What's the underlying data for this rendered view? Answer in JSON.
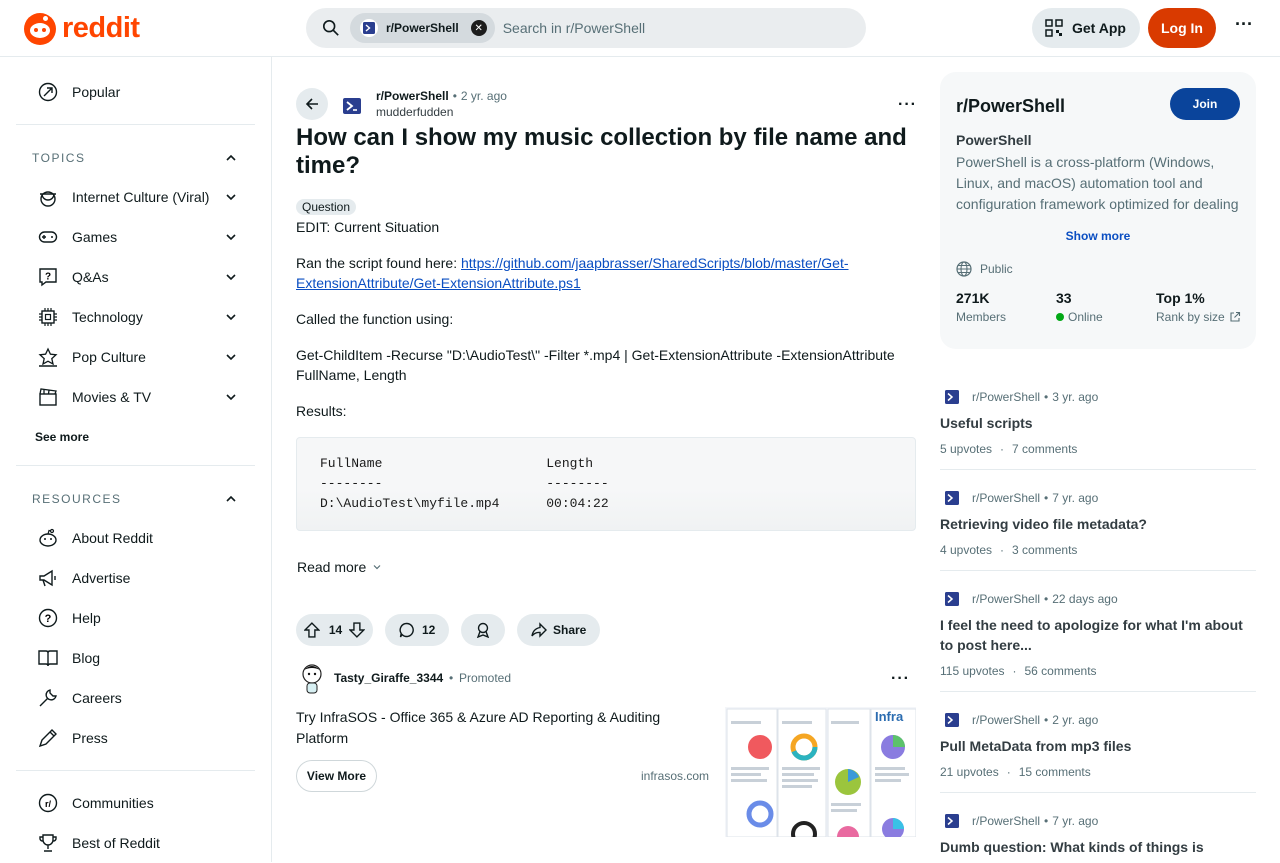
{
  "header": {
    "logo_text": "reddit",
    "search_chip": "r/PowerShell",
    "search_placeholder": "Search in r/PowerShell",
    "get_app": "Get App",
    "login": "Log In"
  },
  "leftnav": {
    "popular": "Popular",
    "topics_heading": "TOPICS",
    "topics": [
      "Internet Culture (Viral)",
      "Games",
      "Q&As",
      "Technology",
      "Pop Culture",
      "Movies & TV"
    ],
    "see_more": "See more",
    "resources_heading": "RESOURCES",
    "resources": [
      "About Reddit",
      "Advertise",
      "Help",
      "Blog",
      "Careers",
      "Press"
    ],
    "bottom": [
      "Communities",
      "Best of Reddit"
    ]
  },
  "post": {
    "subreddit": "r/PowerShell",
    "time": "2 yr. ago",
    "author": "mudderfudden",
    "title": "How can I show my music collection by file name and time?",
    "flair": "Question",
    "edit_line": "EDIT: Current Situation",
    "ran_prefix": "Ran the script found here: ",
    "link": "https://github.com/jaapbrasser/SharedScripts/blob/master/Get-ExtensionAttribute/Get-ExtensionAttribute.ps1",
    "called": "Called the function using:",
    "command": "Get-ChildItem -Recurse \"D:\\AudioTest\\\" -Filter *.mp4 | Get-ExtensionAttribute -ExtensionAttribute FullName, Length",
    "results": "Results:",
    "code_lines": [
      "FullName                     Length",
      "--------                     --------",
      "D:\\AudioTest\\myfile.mp4      00:04:22"
    ],
    "read_more": "Read more",
    "upvotes": "14",
    "comments": "12",
    "share": "Share"
  },
  "promo": {
    "user": "Tasty_Giraffe_3344",
    "tag": "Promoted",
    "title": "Try InfraSOS - Office 365 & Azure AD Reporting & Auditing Platform",
    "button": "View More",
    "domain": "infrasos.com",
    "image_brand": "Infra"
  },
  "about": {
    "name": "r/PowerShell",
    "join": "Join",
    "title": "PowerShell",
    "desc": "PowerShell is a cross-platform (Windows, Linux, and macOS) automation tool and configuration framework optimized for dealing with structured data.",
    "show_more": "Show more",
    "visibility": "Public",
    "members_value": "271K",
    "members_label": "Members",
    "online_value": "33",
    "online_label": "Online",
    "rank_value": "Top 1%",
    "rank_label": "Rank by size"
  },
  "related": [
    {
      "sub": "r/PowerShell",
      "time": "3 yr. ago",
      "title": "Useful scripts",
      "upvotes": "5 upvotes",
      "comments": "7 comments"
    },
    {
      "sub": "r/PowerShell",
      "time": "7 yr. ago",
      "title": "Retrieving video file metadata?",
      "upvotes": "4 upvotes",
      "comments": "3 comments"
    },
    {
      "sub": "r/PowerShell",
      "time": "22 days ago",
      "title": "I feel the need to apologize for what I'm about to post here...",
      "upvotes": "115 upvotes",
      "comments": "56 comments"
    },
    {
      "sub": "r/PowerShell",
      "time": "2 yr. ago",
      "title": "Pull MetaData from mp3 files",
      "upvotes": "21 upvotes",
      "comments": "15 comments"
    },
    {
      "sub": "r/PowerShell",
      "time": "7 yr. ago",
      "title": "Dumb question: What kinds of things is powershell used for",
      "upvotes": "",
      "comments": ""
    }
  ]
}
